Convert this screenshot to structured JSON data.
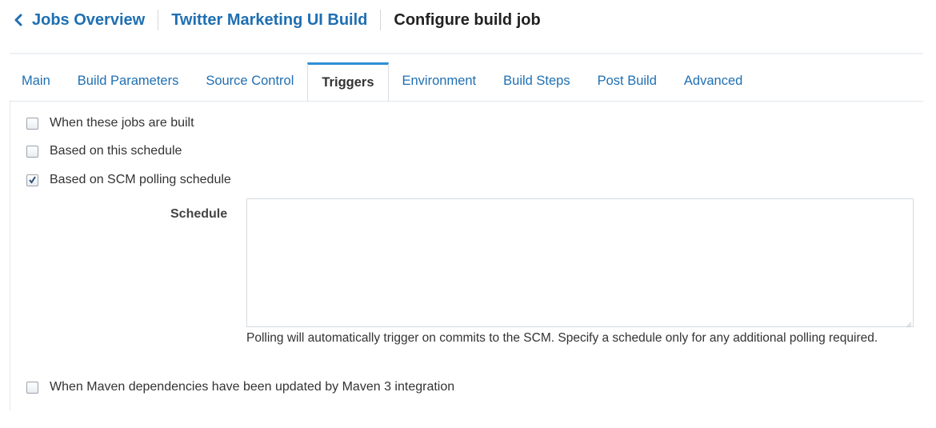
{
  "header": {
    "back_label": "Jobs Overview",
    "job_name": "Twitter Marketing UI Build",
    "page_title": "Configure build job"
  },
  "tabs": [
    {
      "label": "Main",
      "active": false
    },
    {
      "label": "Build Parameters",
      "active": false
    },
    {
      "label": "Source Control",
      "active": false
    },
    {
      "label": "Triggers",
      "active": true
    },
    {
      "label": "Environment",
      "active": false
    },
    {
      "label": "Build Steps",
      "active": false
    },
    {
      "label": "Post Build",
      "active": false
    },
    {
      "label": "Advanced",
      "active": false
    }
  ],
  "triggers": {
    "jobs_built": {
      "label": "When these jobs are built",
      "checked": false
    },
    "schedule": {
      "label": "Based on this schedule",
      "checked": false
    },
    "scm_polling": {
      "label": "Based on SCM polling schedule",
      "checked": true
    },
    "maven": {
      "label": "When Maven dependencies have been updated by Maven 3 integration",
      "checked": false
    }
  },
  "schedule_field": {
    "label": "Schedule",
    "value": "",
    "help": "Polling will automatically trigger on commits to the SCM. Specify a schedule only for any additional polling required."
  },
  "colors": {
    "link": "#1f6fb2",
    "active_tab_accent": "#2e8fd6"
  }
}
